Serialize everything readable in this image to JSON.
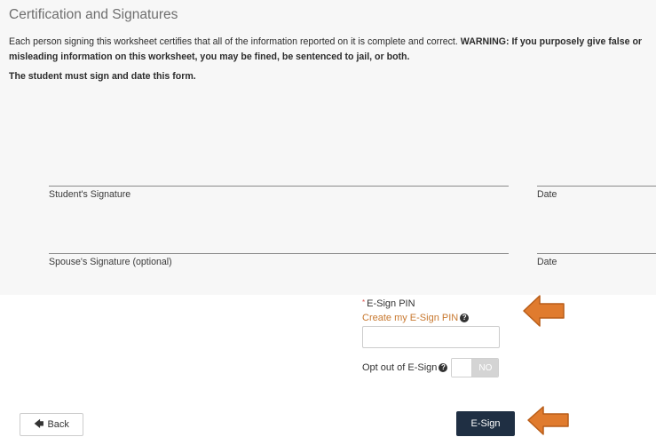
{
  "section": {
    "title": "Certification and Signatures",
    "certify_text": "Each person signing this worksheet certifies that all of the information reported on it is complete and correct.",
    "warning_text": "WARNING: If you purposely give false or misleading information on this worksheet, you may be fined, be sentenced to jail, or both.",
    "must_sign_text": "The student must sign and date this form."
  },
  "signatures": {
    "student_label": "Student's Signature",
    "student_date_label": "Date",
    "spouse_label": "Spouse's Signature (optional)",
    "spouse_date_label": "Date"
  },
  "esign": {
    "required_marker": "*",
    "pin_label": "E-Sign PIN",
    "create_pin_link": "Create my E-Sign PIN",
    "pin_value": "",
    "optout_label": "Opt out of E-Sign",
    "optout_state": "NO"
  },
  "footer": {
    "back_label": "Back",
    "esign_button_label": "E-Sign"
  },
  "colors": {
    "accent_link": "#c8782f",
    "esign_button": "#1f2f43",
    "annotation_arrow": "#e07b2e"
  },
  "icons": {
    "help": "question-circle-icon",
    "back": "arrow-left-icon",
    "annotation": "orange-arrow-icon"
  }
}
